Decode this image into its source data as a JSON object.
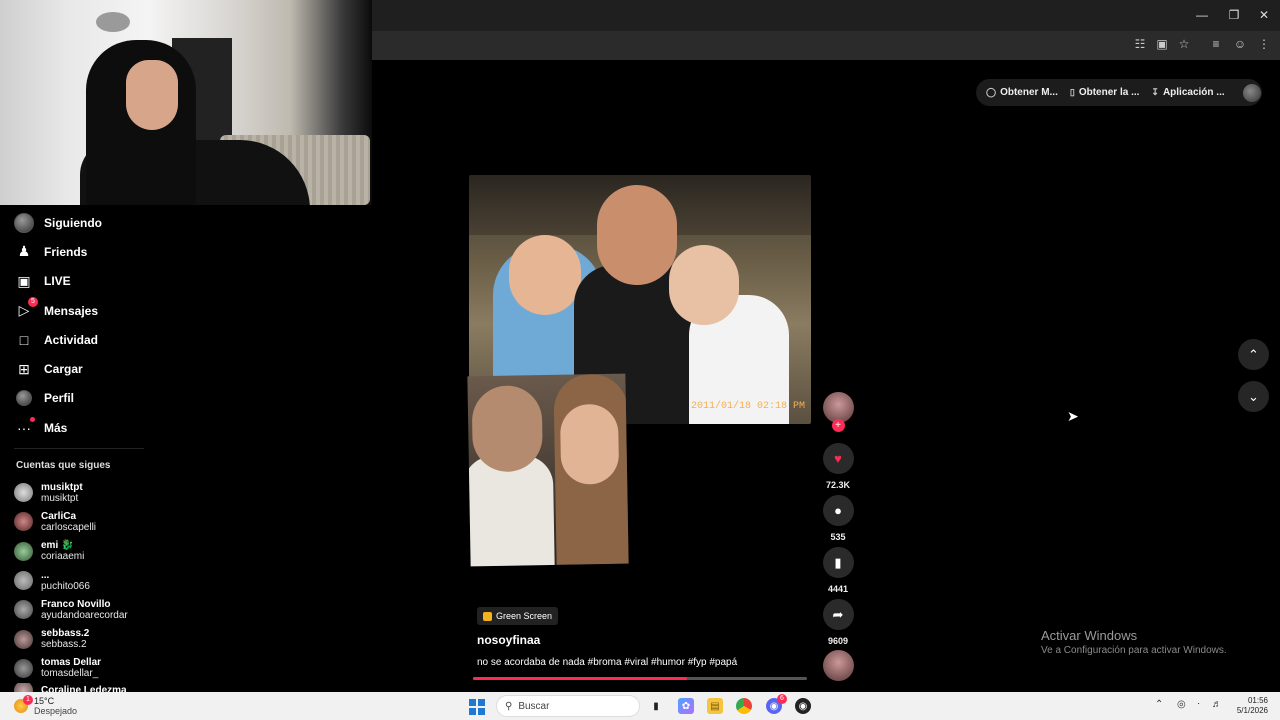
{
  "pills": [
    {
      "label": "Obtener M...",
      "icon": "coin-icon"
    },
    {
      "label": "Obtener la ...",
      "icon": "phone-icon"
    },
    {
      "label": "Aplicación ...",
      "icon": "download-icon"
    }
  ],
  "nav": [
    {
      "label": "Siguiendo",
      "icon": "following-avatar-icon"
    },
    {
      "label": "Friends",
      "icon": "friends-icon"
    },
    {
      "label": "LIVE",
      "icon": "live-icon"
    },
    {
      "label": "Mensajes",
      "icon": "messages-icon",
      "badge": "5"
    },
    {
      "label": "Actividad",
      "icon": "activity-icon"
    },
    {
      "label": "Cargar",
      "icon": "upload-icon"
    },
    {
      "label": "Perfil",
      "icon": "profile-avatar-icon"
    },
    {
      "label": "Más",
      "icon": "more-icon"
    }
  ],
  "following_title": "Cuentas que sigues",
  "following": [
    {
      "name": "musiktpt",
      "user": "musiktpt"
    },
    {
      "name": "CarliCa",
      "user": "carloscapelli"
    },
    {
      "name": "emi 🐉",
      "user": "coriaaemi"
    },
    {
      "name": "...",
      "user": "puchito066"
    },
    {
      "name": "Franco Novillo",
      "user": "ayudandoarecordar"
    },
    {
      "name": "sebbass.2",
      "user": "sebbass.2"
    },
    {
      "name": "tomas Dellar",
      "user": "tomasdellar_"
    },
    {
      "name": "Coraline Ledezma",
      "user": ""
    }
  ],
  "video": {
    "stamp": "2011/01/18 02:18 PM",
    "tag": "Green Screen",
    "author": "nosoyfinaa",
    "caption": "no se acordaba de nada #broma #viral #humor #fyp #papá",
    "progress": 0.64
  },
  "actions": {
    "likes": "72.3K",
    "comments": "535",
    "saves": "4441",
    "shares": "9609"
  },
  "activation": {
    "title": "Activar Windows",
    "subtitle": "Ve a Configuración para activar Windows."
  },
  "taskbar": {
    "temp": "15°C",
    "condition": "Despejado",
    "search_placeholder": "Buscar",
    "time": "01:56",
    "date": "5/1/2026",
    "weather_badge": "1",
    "discord_badge": "6"
  },
  "colors": {
    "accent": "#fe2c55",
    "background": "#000000",
    "taskbar": "#f1f1f1"
  }
}
